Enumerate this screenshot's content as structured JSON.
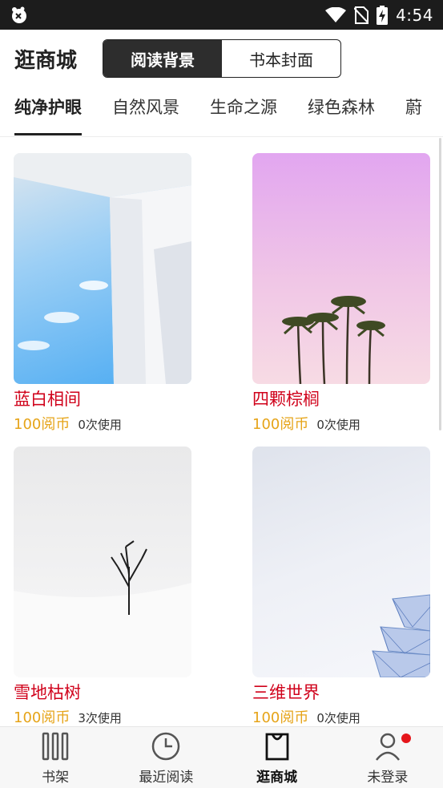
{
  "status_bar": {
    "time": "4:54",
    "icons": [
      "app-icon",
      "wifi-icon",
      "no-sim-icon",
      "battery-charging-icon"
    ]
  },
  "header": {
    "title": "逛商城",
    "segments": [
      {
        "label": "阅读背景",
        "active": true
      },
      {
        "label": "书本封面",
        "active": false
      }
    ]
  },
  "categories": [
    {
      "label": "纯净护眼",
      "active": true
    },
    {
      "label": "自然风景",
      "active": false
    },
    {
      "label": "生命之源",
      "active": false
    },
    {
      "label": "绿色森林",
      "active": false
    },
    {
      "label": "蔚",
      "active": false
    }
  ],
  "items": [
    {
      "name": "蓝白相间",
      "price": "100阅币",
      "usage": "0次使用"
    },
    {
      "name": "四颗棕榈",
      "price": "100阅币",
      "usage": "0次使用"
    },
    {
      "name": "雪地枯树",
      "price": "100阅币",
      "usage": "3次使用"
    },
    {
      "name": "三维世界",
      "price": "100阅币",
      "usage": "0次使用"
    }
  ],
  "bottom_nav": [
    {
      "label": "书架",
      "icon": "bookshelf-icon",
      "active": false
    },
    {
      "label": "最近阅读",
      "icon": "clock-icon",
      "active": false
    },
    {
      "label": "逛商城",
      "icon": "shopping-bag-icon",
      "active": true
    },
    {
      "label": "未登录",
      "icon": "user-icon",
      "active": false
    }
  ],
  "colors": {
    "item_name": "#d0021b",
    "price": "#e6a419",
    "status_bar": "#1c1c1c",
    "badge": "#e5161b"
  }
}
